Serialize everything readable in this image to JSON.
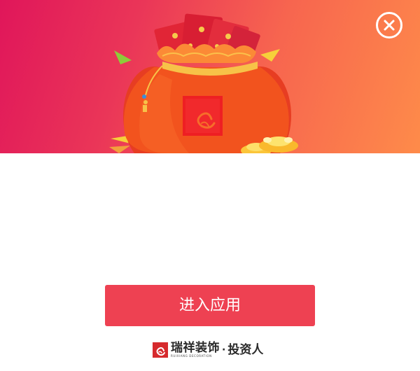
{
  "buttons": {
    "enter": "进入应用"
  },
  "brand": {
    "company_name": "瑞祥装饰",
    "company_name_en": "RUIXIANG DECORATION",
    "separator": "·",
    "app_name": "投资人"
  },
  "icons": {
    "close": "close-circle-icon",
    "banner": "red-envelope-lucky-bag-illustration",
    "logo": "ruixiang-logo-icon"
  },
  "colors": {
    "banner_start": "#e0165a",
    "banner_end": "#fe8b4a",
    "primary_button": "#ee4152",
    "logo_red": "#d62a2d"
  }
}
